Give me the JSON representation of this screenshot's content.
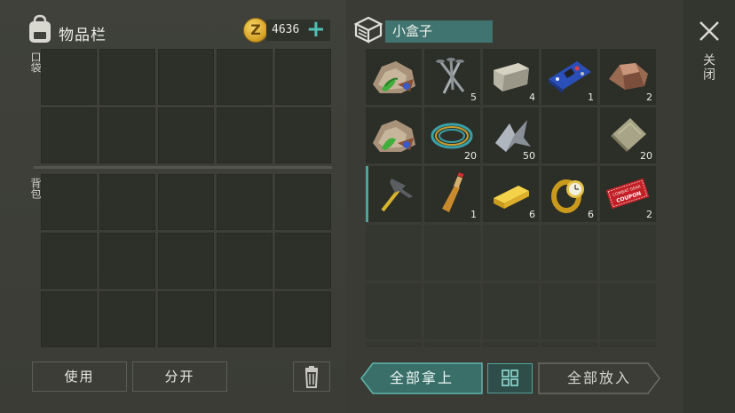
{
  "inventory": {
    "title": "物品栏",
    "pocket_label": "口袋",
    "backpack_label": "背包",
    "currency_amount": "4636",
    "coin_symbol": "Z"
  },
  "buttons": {
    "use": "使用",
    "split": "分开",
    "take_all": "全部拿上",
    "put_all": "全部放入",
    "close": "关闭"
  },
  "container": {
    "title": "小盒子",
    "items": [
      {
        "name": "plant-ore-icon",
        "count": ""
      },
      {
        "name": "nails-icon",
        "count": "5"
      },
      {
        "name": "stone-block-icon",
        "count": "4"
      },
      {
        "name": "circuit-board-icon",
        "count": "1"
      },
      {
        "name": "ore-rock-icon",
        "count": "2"
      },
      {
        "name": "plant-ore-icon",
        "count": ""
      },
      {
        "name": "wire-coil-icon",
        "count": "20"
      },
      {
        "name": "scrap-metal-icon",
        "count": "50"
      },
      {
        "name": "empty-slot",
        "count": ""
      },
      {
        "name": "cloth-icon",
        "count": "20"
      },
      {
        "name": "hammer-icon",
        "count": ""
      },
      {
        "name": "bottle-icon",
        "count": "1"
      },
      {
        "name": "gold-bar-icon",
        "count": "6"
      },
      {
        "name": "gold-watch-icon",
        "count": "6"
      },
      {
        "name": "coupon-icon",
        "count": "2"
      }
    ],
    "coupon_text_1": "COMBAT GEAR",
    "coupon_text_2": "COUPON"
  },
  "colors": {
    "accent": "#4fc0b3",
    "title_bg": "#3f7470",
    "take_all_bg": "#3a6f69"
  }
}
